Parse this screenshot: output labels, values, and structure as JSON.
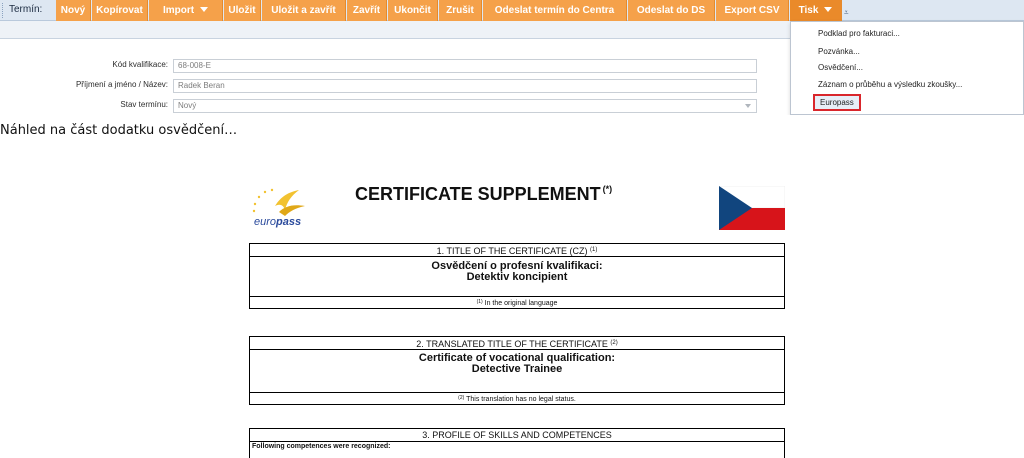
{
  "toolbar": {
    "label": "Termín:",
    "buttons": [
      "Nový",
      "Kopírovat",
      "Import",
      "Uložit",
      "Uložit a zavřít",
      "Zavřít",
      "Ukončit",
      "Zrušit",
      "Odeslat termín do Centra",
      "Odeslat do DS",
      "Export CSV",
      "Tisk"
    ],
    "overflow_glyph": "⩡"
  },
  "form": {
    "rows": [
      {
        "label": "Kód kvalifikace:",
        "value": "68-008-E"
      },
      {
        "label": "Příjmení a jméno / Název:",
        "value": "Radek Beran"
      },
      {
        "label": "Stav termínu:",
        "value": "Nový"
      }
    ]
  },
  "print_menu": {
    "items": [
      "Podklad pro fakturaci...",
      "Pozvánka...",
      "Osvědčení...",
      "Záznam o průběhu a výsledku zkoušky...",
      "Europass"
    ]
  },
  "caption": "Náhled na část dodatku osvědčení…",
  "certificate": {
    "logo_prefix": "euro",
    "logo_suffix": "pass",
    "title": "CERTIFICATE SUPPLEMENT",
    "title_mark": "(*)",
    "sections": [
      {
        "heading": "1. TITLE OF THE CERTIFICATE (CZ)",
        "heading_mark": "(1)",
        "line1": "Osvědčení o profesní kvalifikaci:",
        "line2": "Detektiv koncipient",
        "note_mark": "(1)",
        "note": "In the original language"
      },
      {
        "heading": "2. TRANSLATED TITLE OF THE CERTIFICATE",
        "heading_mark": "(2)",
        "line1": "Certificate of vocational qualification:",
        "line2": "Detective Trainee",
        "note_mark": "(2)",
        "note": "This translation has no legal status."
      },
      {
        "heading": "3. PROFILE OF SKILLS AND COMPETENCES",
        "text": "Following competences were recognized:"
      }
    ]
  },
  "colors": {
    "toolbar_button": "#f5a14a",
    "toolbar_bg": "#dde7f2",
    "menu_highlight_border": "#d9262c",
    "europass_blue": "#2a4a9c",
    "europass_star": "#f2c230",
    "flag_blue": "#11457e",
    "flag_red": "#d7141a"
  }
}
